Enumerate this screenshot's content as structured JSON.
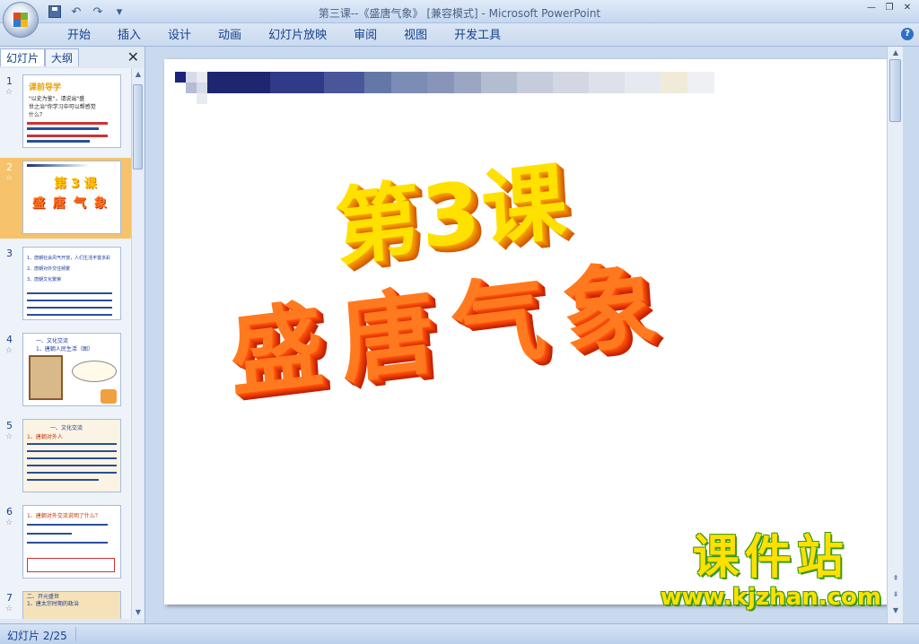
{
  "window": {
    "title": "第三课--《盛唐气象》 [兼容模式] - Microsoft PowerPoint",
    "controls": [
      "—",
      "❐",
      "✕"
    ]
  },
  "quick_access": {
    "save_icon": "save-icon",
    "undo": "↶",
    "redo": "↷",
    "customize": "▾"
  },
  "ribbon": {
    "tabs": [
      "开始",
      "插入",
      "设计",
      "动画",
      "幻灯片放映",
      "审阅",
      "视图",
      "开发工具"
    ],
    "help": "?"
  },
  "left_pane": {
    "tabs": [
      "幻灯片",
      "大纲"
    ],
    "close": "✕",
    "slides": [
      {
        "number": "1",
        "title": "课前导学",
        "lines": [
          "\"以史为鉴\"，请说出\"盛",
          "世之治\"你学习中可以帮感觉",
          "什么？"
        ]
      },
      {
        "number": "2",
        "title": "第 3 课",
        "subtitle": "盛 唐 气 象"
      },
      {
        "number": "3",
        "lines": [
          "1、唐朝社会风气开放，人们生活丰富多彩",
          "2、唐朝对外交往频繁",
          "3、唐朝文化繁荣"
        ]
      },
      {
        "number": "4",
        "lines": [
          "一、文化交流",
          "1、唐朝人民生活（图）"
        ]
      },
      {
        "number": "5",
        "lines": [
          "一、文化交流",
          "1、唐朝对外人"
        ]
      },
      {
        "number": "6",
        "lines": [
          "1、唐朝对外交流说明了什么？"
        ]
      },
      {
        "number": "7",
        "lines": [
          "二、开元盛世",
          "1、唐太宗时期的政治"
        ]
      }
    ]
  },
  "slide": {
    "title_line1": "第3课",
    "title_line2": "盛唐气象"
  },
  "watermark": {
    "name": "课件站",
    "url": "www.kjzhan.com"
  },
  "statusbar": {
    "slide_info": "幻灯片 2/25"
  },
  "colors": {
    "wordart_top": "#ffe100",
    "wordart_bottom": "#ff7a1e",
    "selected_slide": "#f6c26b",
    "ribbon_text": "#15428b"
  }
}
